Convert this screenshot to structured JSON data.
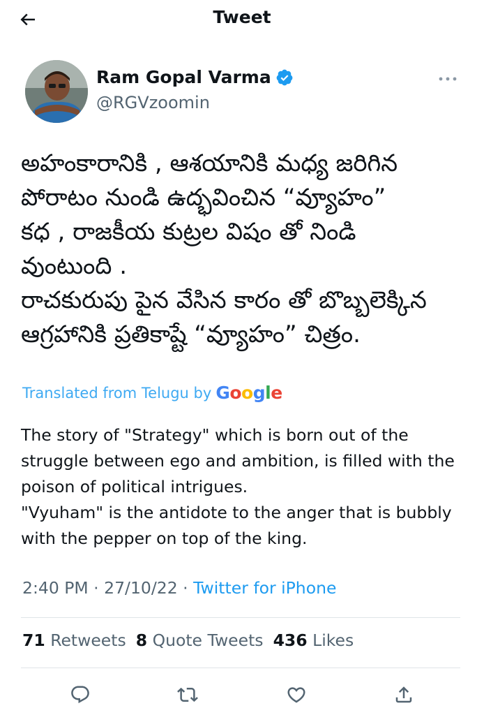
{
  "header": {
    "title": "Tweet",
    "back_icon": "arrow-left-icon"
  },
  "author": {
    "name": "Ram Gopal Varma",
    "handle": "@RGVzoomin",
    "verified": true,
    "verified_color": "#1d9bf0",
    "more_icon": "more-horizontal-icon"
  },
  "tweet": {
    "text_lines": [
      "అహంకారానికి , ఆశయానికి మధ్య జరిగిన",
      "పోరాటం నుండి ఉద్భవించిన “వ్యూహం”",
      "కధ , రాజకీయ కుట్రల విషం తో నిండి",
      "వుంటుంది .",
      "రాచకురుపు పైన వేసిన కారం తో బొబ్బలెక్కిన",
      "ఆగ్రహానికి ప్రతికాష్టే “వ్యూహం” చిత్రం."
    ]
  },
  "translation": {
    "label": "Translated from Telugu by",
    "provider": "Google",
    "text_lines": [
      "The story of \"Strategy\" which is born out of the",
      "struggle between ego and ambition, is filled with the",
      "poison of political intrigues.",
      "\"Vyuham\" is the antidote to the anger that is bubbly",
      "with the pepper on top of the king."
    ]
  },
  "meta": {
    "time": "2:40 PM",
    "separator": " · ",
    "date": "27/10/22",
    "source": "Twitter for iPhone"
  },
  "stats": {
    "retweets_count": "71",
    "retweets_label": "Retweets",
    "quotes_count": "8",
    "quotes_label": "Quote Tweets",
    "likes_count": "436",
    "likes_label": "Likes"
  },
  "actions": {
    "reply_icon": "reply-icon",
    "retweet_icon": "retweet-icon",
    "like_icon": "heart-icon",
    "share_icon": "share-icon"
  },
  "colors": {
    "accent": "#1d9bf0",
    "text": "#0f1419",
    "secondary": "#536471",
    "divider": "#dfe4e8"
  }
}
